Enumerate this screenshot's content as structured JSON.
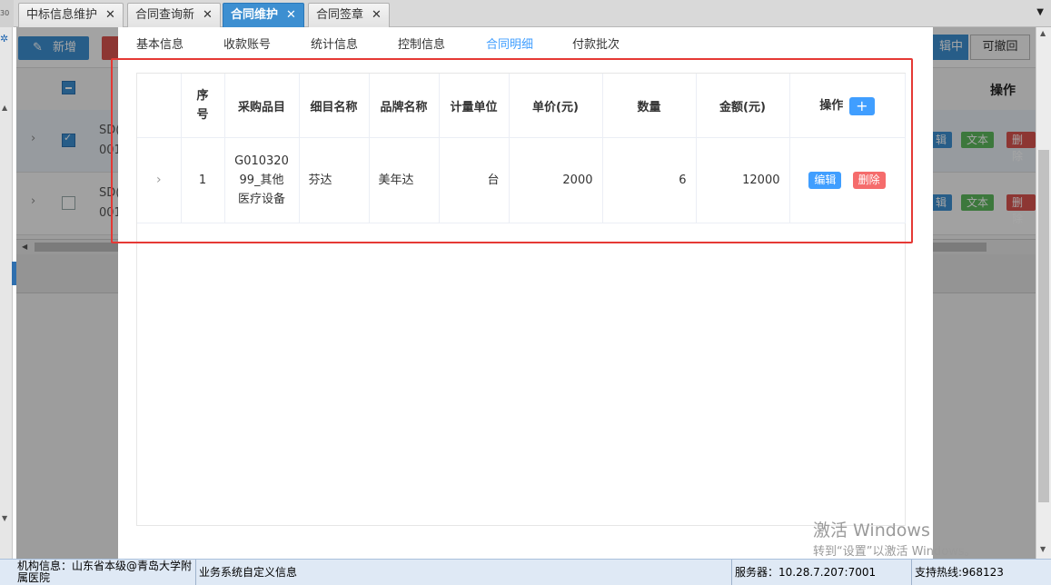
{
  "top_tabs": [
    {
      "label": "中标信息维护",
      "active": false
    },
    {
      "label": "合同查询新",
      "active": false
    },
    {
      "label": "合同维护",
      "active": true
    },
    {
      "label": "合同签章",
      "active": false
    }
  ],
  "tab_close_glyph": "✕",
  "tab_stub_text": "30",
  "background_page": {
    "new_button_label": "新增",
    "right_button1_label": "辑中",
    "right_button2_label": "可撤回",
    "header_op_label": "操作",
    "rows": [
      {
        "code_line1": "SD(",
        "code_line2": "001",
        "checked": true,
        "btn_edit": "辑",
        "btn_text": "文本",
        "btn_delete": "删除"
      },
      {
        "code_line1": "SD(",
        "code_line2": "001",
        "checked": false,
        "btn_edit": "辑",
        "btn_text": "文本",
        "btn_delete": "删除"
      }
    ]
  },
  "modal": {
    "tabs": [
      {
        "label": "基本信息",
        "active": false
      },
      {
        "label": "收款账号",
        "active": false
      },
      {
        "label": "统计信息",
        "active": false
      },
      {
        "label": "控制信息",
        "active": false
      },
      {
        "label": "合同明细",
        "active": true
      },
      {
        "label": "付款批次",
        "active": false
      }
    ],
    "table": {
      "headers": [
        "",
        "序号",
        "采购品目",
        "细目名称",
        "品牌名称",
        "计量单位",
        "单价(元)",
        "数量",
        "金额(元)",
        "操作"
      ],
      "add_button": "+",
      "rows": [
        {
          "index": "1",
          "category": "G01032099_其他医疗设备",
          "item_name": "芬达",
          "brand": "美年达",
          "unit": "台",
          "unit_price": "2000",
          "quantity": "6",
          "amount": "12000",
          "edit_label": "编辑",
          "delete_label": "删除"
        }
      ]
    }
  },
  "watermark": {
    "line1": "激活 Windows",
    "line2": "转到“设置”以激活 Windows。"
  },
  "status_bar": {
    "org_info": "机构信息：山东省本级@青岛大学附属医院",
    "custom_info": "业务系统自定义信息",
    "server": "服务器：10.28.7.207:7001",
    "hotline": "支持热线:968123"
  },
  "colors": {
    "accent": "#409eff",
    "danger": "#f56c6c",
    "tab_active": "#3d8fd1",
    "highlight_box": "#e53935"
  }
}
